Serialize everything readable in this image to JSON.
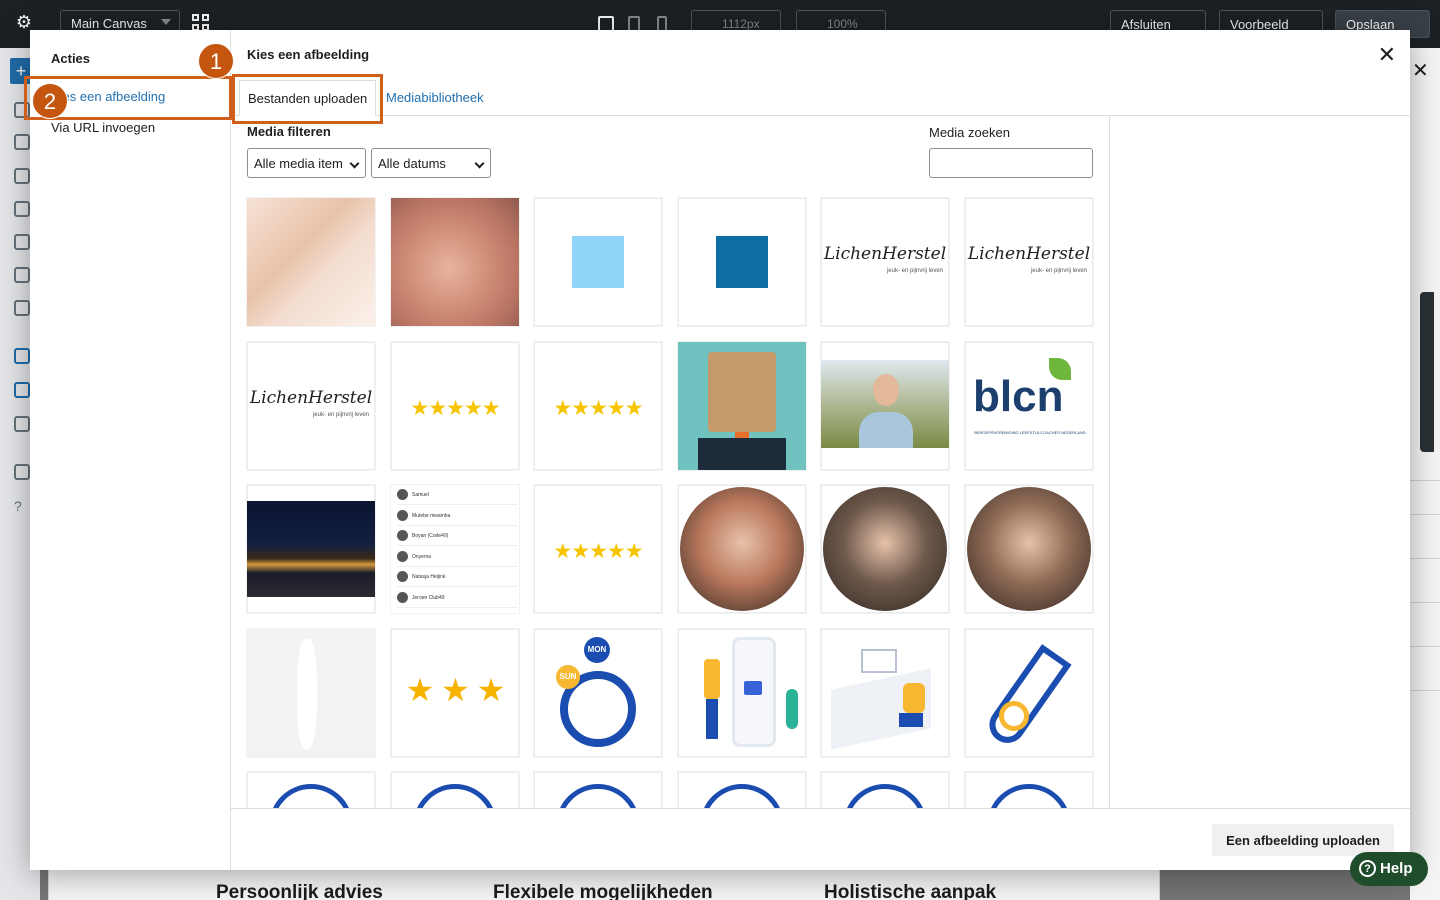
{
  "editor": {
    "canvas_select": "Main Canvas",
    "width_field": "1112px",
    "zoom_field": "100%",
    "close_label": "Afsluiten",
    "preview_label": "Voorbeeld",
    "save_label": "Opslaan",
    "bg_headings": [
      "Persoonlijk advies",
      "Flexibele mogelijkheden",
      "Holistische aanpak"
    ]
  },
  "modal": {
    "menu_heading": "Acties",
    "menu_items": [
      "Kies een afbeelding",
      "Via URL invoegen"
    ],
    "title": "Kies een afbeelding",
    "tabs": [
      "Bestanden uploaden",
      "Mediabibliotheek"
    ],
    "filter_label": "Media filteren",
    "filter_type": "Alle media item",
    "filter_date": "Alle datums",
    "search_label": "Media zoeken",
    "upload_button": "Een afbeelding uploaden"
  },
  "media_items": [
    {
      "kind": "photo-hands",
      "alt": "massage"
    },
    {
      "kind": "photo-skin",
      "alt": "needle"
    },
    {
      "kind": "square",
      "color": "#8fd4f9"
    },
    {
      "kind": "square",
      "color": "#0e6ea4"
    },
    {
      "kind": "logo",
      "text": "LichenHerstel",
      "sub": "jeuk- en pijnvrij leven"
    },
    {
      "kind": "logo",
      "text": "LichenHerstel",
      "sub": "jeuk- en pijnvrij leven"
    },
    {
      "kind": "logo",
      "text": "LichenHerstel",
      "sub": "jeuk- en pijnvrij leven"
    },
    {
      "kind": "stars",
      "text": "★★★★★"
    },
    {
      "kind": "stars",
      "text": "★★★★★"
    },
    {
      "kind": "photo-bag",
      "alt": "smiley bag"
    },
    {
      "kind": "photo-woman",
      "alt": "woman outdoors"
    },
    {
      "kind": "blcn",
      "text": "blcn",
      "sub": "BEROEPSVERENIGING LEEFSTIJLCOACHES NEDERLAND"
    },
    {
      "kind": "photo-night",
      "alt": "city night"
    },
    {
      "kind": "chatlist",
      "names": [
        "Samuel",
        "Mutebe mwamba",
        "Boyan (Code49)",
        "Onyema",
        "Natasja Heijink",
        "Jeroen Club49"
      ]
    },
    {
      "kind": "stars",
      "text": "★★★★★"
    },
    {
      "kind": "circle",
      "color": "#b9785c"
    },
    {
      "kind": "circle",
      "color": "#6f5a4c"
    },
    {
      "kind": "circle",
      "color": "#8e6a55"
    },
    {
      "kind": "faint",
      "alt": "placeholder"
    },
    {
      "kind": "stars3",
      "text": "★ ★ ★"
    },
    {
      "kind": "illus-clock",
      "text1": "MON",
      "text2": "SUN"
    },
    {
      "kind": "illus-shop",
      "alt": "shopping"
    },
    {
      "kind": "illus-desk",
      "alt": "desk"
    },
    {
      "kind": "illus-tube",
      "alt": "test tube"
    },
    {
      "kind": "partial",
      "alt": "icon"
    },
    {
      "kind": "partial",
      "alt": "icon"
    },
    {
      "kind": "partial",
      "alt": "icon"
    },
    {
      "kind": "partial",
      "alt": "icon"
    },
    {
      "kind": "partial",
      "alt": "icon"
    },
    {
      "kind": "partial",
      "alt": "icon"
    }
  ],
  "annotations": [
    "1",
    "2"
  ],
  "help_label": "Help",
  "colors": {
    "accent": "#2271b1",
    "annotation": "#cf5f1a",
    "help": "#1f4d2c"
  }
}
